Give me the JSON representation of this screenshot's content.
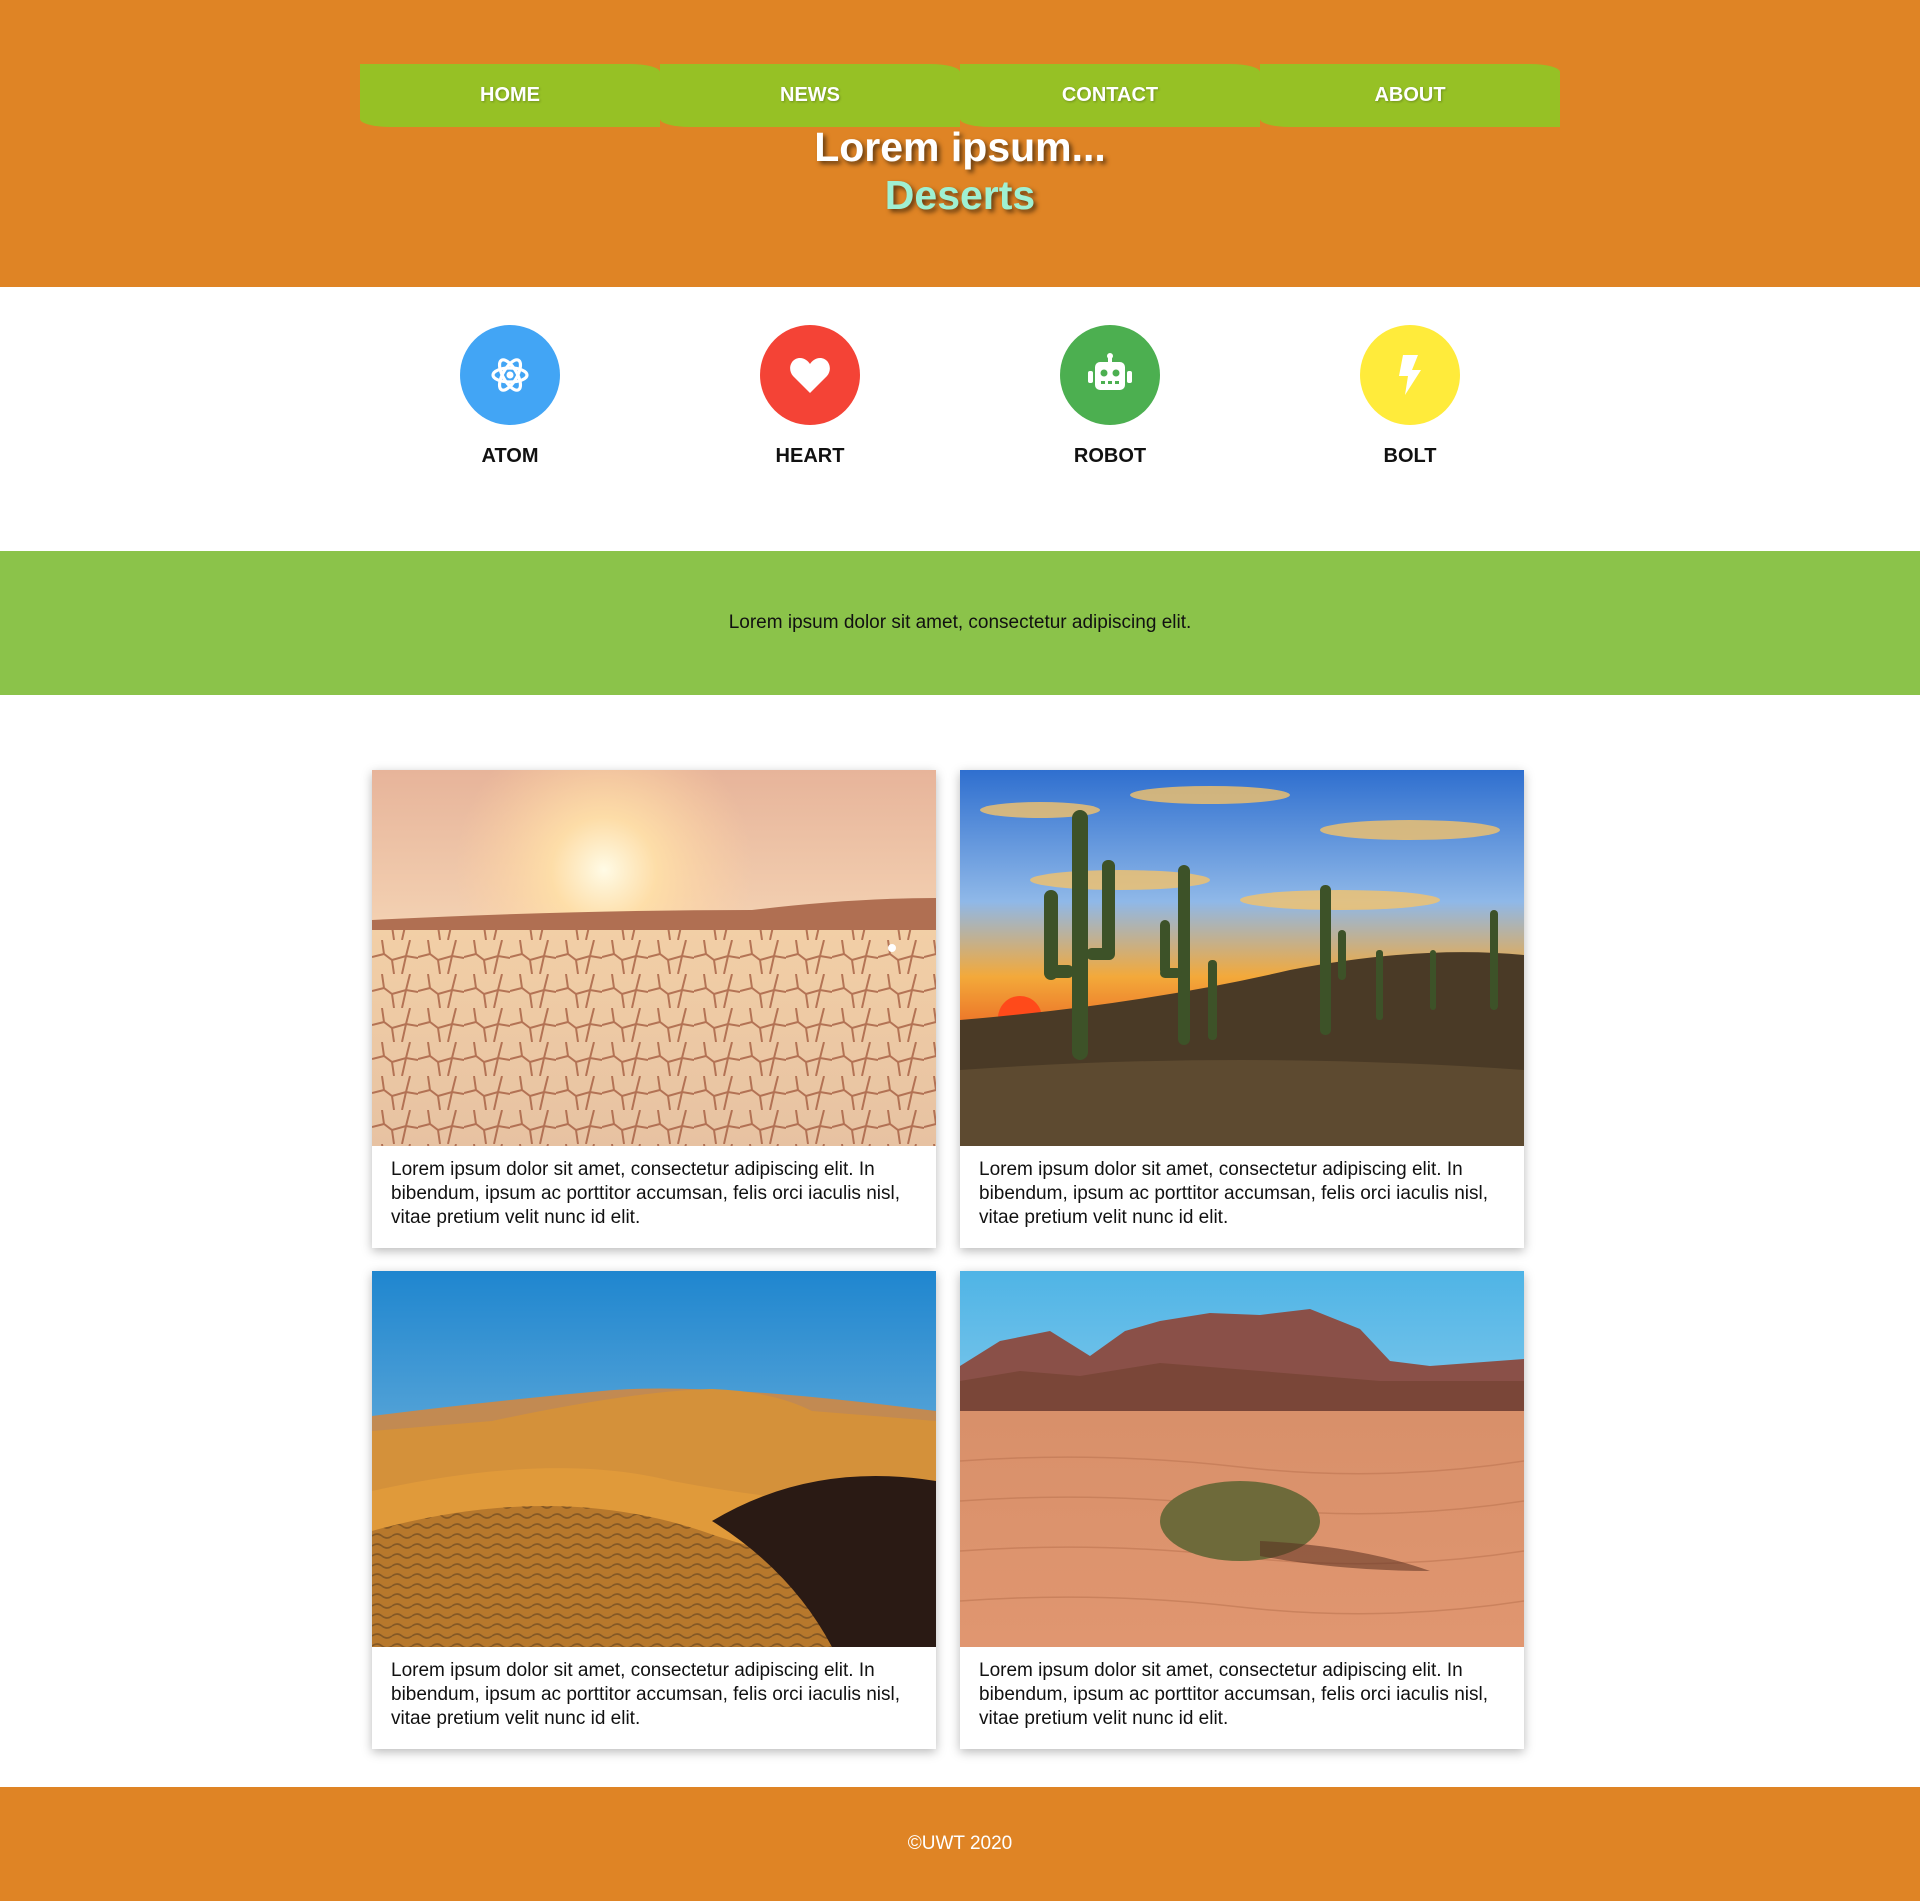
{
  "nav": {
    "items": [
      {
        "label": "HOME"
      },
      {
        "label": "NEWS"
      },
      {
        "label": "CONTACT"
      },
      {
        "label": "ABOUT"
      }
    ]
  },
  "hero": {
    "title": "Lorem ipsum...",
    "subtitle": "Deserts"
  },
  "features": [
    {
      "label": "ATOM",
      "icon": "atom-icon",
      "color": "#42a5f5"
    },
    {
      "label": "HEART",
      "icon": "heart-icon",
      "color": "#f44336"
    },
    {
      "label": "ROBOT",
      "icon": "robot-icon",
      "color": "#4caf50"
    },
    {
      "label": "BOLT",
      "icon": "bolt-icon",
      "color": "#ffeb3b"
    }
  ],
  "banner": {
    "text": "Lorem ipsum dolor sit amet, consectetur adipiscing elit."
  },
  "cards": [
    {
      "image": "cracked-earth-sunset-photo",
      "text": "Lorem ipsum dolor sit amet, consectetur adipiscing elit. In bibendum, ipsum ac porttitor accumsan, felis orci iaculis nisl, vitae pretium velit nunc id elit."
    },
    {
      "image": "saguaro-cactus-sunset-photo",
      "text": "Lorem ipsum dolor sit amet, consectetur adipiscing elit. In bibendum, ipsum ac porttitor accumsan, felis orci iaculis nisl, vitae pretium velit nunc id elit."
    },
    {
      "image": "sand-dunes-photo",
      "text": "Lorem ipsum dolor sit amet, consectetur adipiscing elit. In bibendum, ipsum ac porttitor accumsan, felis orci iaculis nisl, vitae pretium velit nunc id elit."
    },
    {
      "image": "red-desert-mountains-photo",
      "text": "Lorem ipsum dolor sit amet, consectetur adipiscing elit. In bibendum, ipsum ac porttitor accumsan, felis orci iaculis nisl, vitae pretium velit nunc id elit."
    }
  ],
  "footer": {
    "text": "©UWT 2020"
  },
  "colors": {
    "header_bg": "#df8425",
    "nav_bg": "#96c125",
    "subtitle": "#9ff0d2",
    "banner_bg": "#8bc34a",
    "footer_bg": "#df8425"
  }
}
